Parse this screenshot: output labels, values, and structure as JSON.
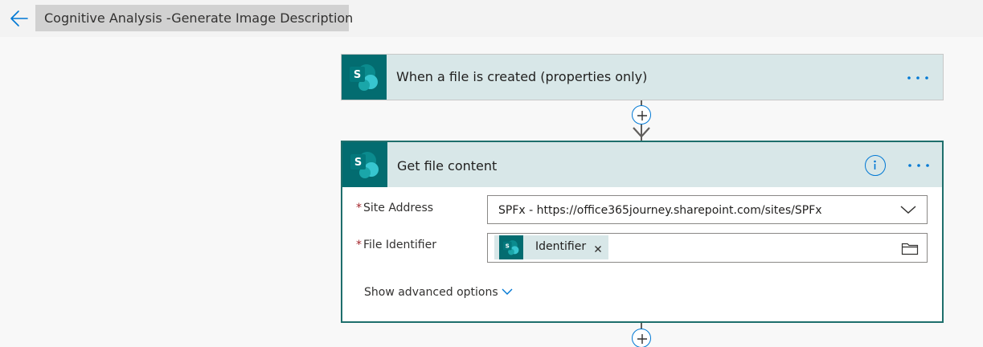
{
  "header": {
    "title": "Cognitive Analysis -Generate Image Description",
    "back_icon": "arrow-left-icon"
  },
  "steps": [
    {
      "title": "When a file is created (properties only)",
      "icon": "sharepoint-icon",
      "more_icon": "ellipsis-icon"
    },
    {
      "title": "Get file content",
      "icon": "sharepoint-icon",
      "info_icon": "info-icon",
      "more_icon": "ellipsis-icon",
      "fields": [
        {
          "label": "Site Address",
          "required_mark": "*",
          "value": "SPFx - https://office365journey.sharepoint.com/sites/SPFx"
        },
        {
          "label": "File Identifier",
          "required_mark": "*",
          "token_label": "Identifier"
        }
      ],
      "advanced_label": "Show advanced options"
    }
  ],
  "colors": {
    "sharepoint_teal": "#036c70",
    "header_bg": "#d8e7e8",
    "accent_blue": "#0078d4",
    "selected_border": "#1e6f6c"
  }
}
